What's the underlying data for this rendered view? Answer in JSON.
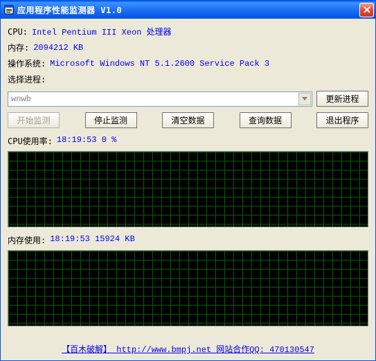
{
  "window": {
    "title": "应用程序性能监测器  V1.0"
  },
  "info": {
    "cpu_label": "CPU:",
    "cpu_value": "Intel Pentium III Xeon 处理器",
    "mem_label": "内存:",
    "mem_value": "2094212 KB",
    "os_label": "操作系统:",
    "os_value": "Microsoft Windows NT 5.1.2600 Service Pack 3"
  },
  "process": {
    "label": "选择进程:",
    "selected": "wnwb"
  },
  "buttons": {
    "refresh": "更新进程",
    "start": "开始监测",
    "stop": "停止监测",
    "clear": "清空数据",
    "query": "查询数据",
    "exit": "退出程序"
  },
  "cpu_usage": {
    "label": "CPU使用率:",
    "value": "18:19:53 0 %"
  },
  "mem_usage": {
    "label": "内存使用:",
    "value": "18:19:53 15924 KB"
  },
  "footer": {
    "text": "【百木破解】 http://www.bmpj.net  网站合作QQ: 470130547"
  }
}
